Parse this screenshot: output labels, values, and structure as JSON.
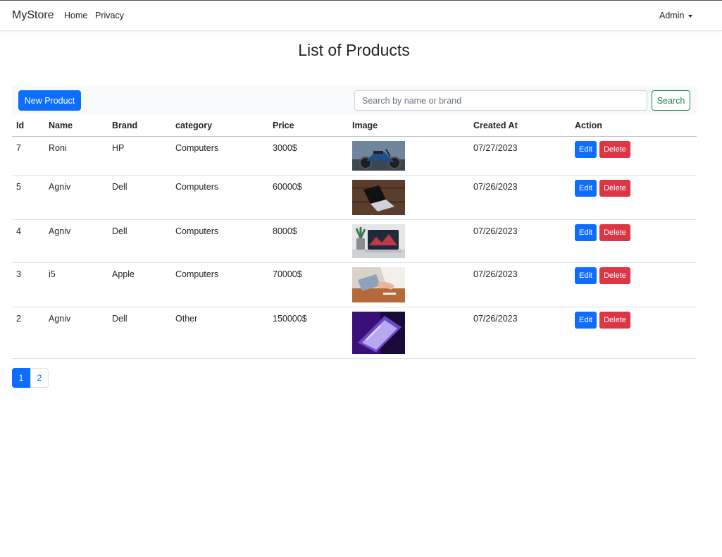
{
  "nav": {
    "brand": "MyStore",
    "links": [
      "Home",
      "Privacy"
    ],
    "user": "Admin"
  },
  "page": {
    "title": "List of Products"
  },
  "toolbar": {
    "new_label": "New Product",
    "search_placeholder": "Search by name or brand",
    "search_value": "",
    "search_label": "Search"
  },
  "table": {
    "headers": [
      "Id",
      "Name",
      "Brand",
      "category",
      "Price",
      "Image",
      "Created At",
      "Action"
    ],
    "rows": [
      {
        "id": "7",
        "name": "Roni",
        "brand": "HP",
        "category": "Computers",
        "price": "3000$",
        "created": "07/27/2023",
        "image": "motorcycle-photo"
      },
      {
        "id": "5",
        "name": "Agniv",
        "brand": "Dell",
        "category": "Computers",
        "price": "60000$",
        "created": "07/26/2023",
        "image": "laptop-on-desk-photo"
      },
      {
        "id": "4",
        "name": "Agniv",
        "brand": "Dell",
        "category": "Computers",
        "price": "8000$",
        "created": "07/26/2023",
        "image": "macbook-plant-photo"
      },
      {
        "id": "3",
        "name": "i5",
        "brand": "Apple",
        "category": "Computers",
        "price": "70000$",
        "created": "07/26/2023",
        "image": "person-typing-photo"
      },
      {
        "id": "2",
        "name": "Agniv",
        "brand": "Dell",
        "category": "Other",
        "price": "150000$",
        "created": "07/26/2023",
        "image": "purple-laptop-photo"
      }
    ],
    "edit_label": "Edit",
    "delete_label": "Delete"
  },
  "pagination": {
    "pages": [
      "1",
      "2"
    ],
    "active": "1"
  },
  "colors": {
    "primary": "#0d6efd",
    "danger": "#dc3545",
    "success": "#198754"
  }
}
